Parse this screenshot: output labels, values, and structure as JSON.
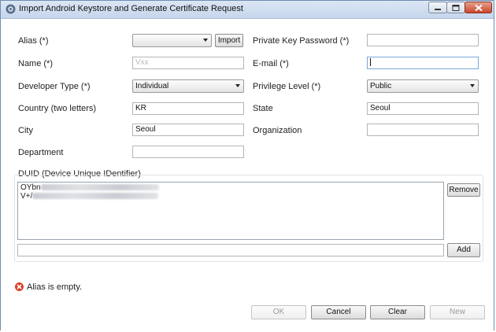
{
  "window": {
    "title": "Import Android Keystore and Generate Certificate Request"
  },
  "form": {
    "alias": {
      "label": "Alias (*)",
      "value": "",
      "import_label": "Import"
    },
    "private_key_password": {
      "label": "Private Key Password (*)",
      "value": ""
    },
    "name": {
      "label": "Name (*)",
      "value": "Vxx"
    },
    "email": {
      "label": "E-mail (*)",
      "value": ""
    },
    "developer_type": {
      "label": "Developer Type (*)",
      "value": "Individual"
    },
    "privilege_level": {
      "label": "Privilege Level (*)",
      "value": "Public"
    },
    "country": {
      "label": "Country (two letters)",
      "value": "KR"
    },
    "state": {
      "label": "State",
      "value": "Seoul"
    },
    "city": {
      "label": "City",
      "value": "Seoul"
    },
    "organization": {
      "label": "Organization",
      "value": ""
    },
    "department": {
      "label": "Department",
      "value": ""
    }
  },
  "duid": {
    "label": "DUID (Device Unique IDentifier)",
    "lines": [
      "OYbn",
      "V+/"
    ],
    "remove_label": "Remove",
    "add_label": "Add",
    "new_value": ""
  },
  "status": {
    "message": "Alias is empty.",
    "icon": "error-icon",
    "color": "#d9412b"
  },
  "footer": {
    "ok_label": "OK",
    "cancel_label": "Cancel",
    "clear_label": "Clear",
    "new_label": "New"
  }
}
